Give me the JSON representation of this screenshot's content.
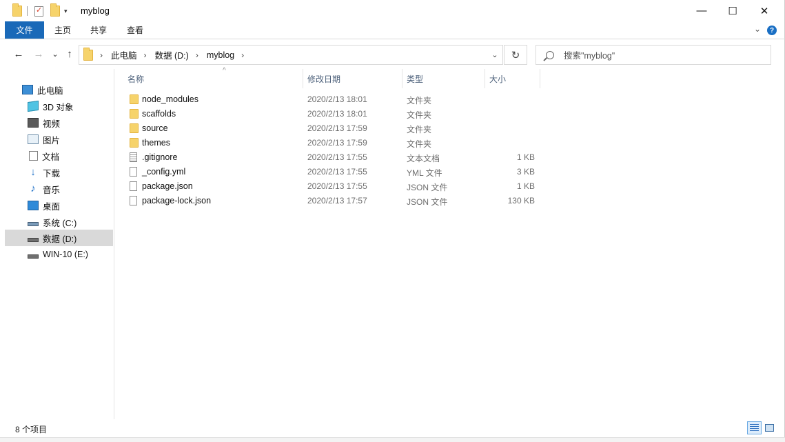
{
  "window": {
    "title": "myblog",
    "minimize_glyph": "—",
    "maximize_glyph": "☐",
    "close_glyph": "✕"
  },
  "ribbon": {
    "tabs": [
      {
        "label": "文件"
      },
      {
        "label": "主页"
      },
      {
        "label": "共享"
      },
      {
        "label": "查看"
      }
    ],
    "collapse_glyph": "⌄",
    "help_glyph": "?"
  },
  "nav": {
    "back_glyph": "←",
    "forward_glyph": "→",
    "recent_glyph": "⌄",
    "up_glyph": "↑",
    "breadcrumbs": [
      "此电脑",
      "数据 (D:)",
      "myblog"
    ],
    "crumb_sep": "›",
    "address_dropdown_glyph": "⌄",
    "refresh_glyph": "↻",
    "search_placeholder": "搜索\"myblog\""
  },
  "sidebar": {
    "items": [
      {
        "label": "此电脑",
        "icon": "computer-icon"
      },
      {
        "label": "3D 对象",
        "icon": "3d-objects-icon"
      },
      {
        "label": "视频",
        "icon": "video-icon"
      },
      {
        "label": "图片",
        "icon": "pictures-icon"
      },
      {
        "label": "文档",
        "icon": "documents-icon"
      },
      {
        "label": "下载",
        "icon": "download-icon"
      },
      {
        "label": "音乐",
        "icon": "music-icon"
      },
      {
        "label": "桌面",
        "icon": "desktop-icon"
      },
      {
        "label": "系统 (C:)",
        "icon": "system-drive-icon"
      },
      {
        "label": "数据 (D:)",
        "icon": "drive-icon"
      },
      {
        "label": "WIN-10 (E:)",
        "icon": "drive-icon"
      }
    ],
    "selected": "数据 (D:)"
  },
  "list": {
    "columns": {
      "name": "名称",
      "modified": "修改日期",
      "type": "类型",
      "size": "大小"
    },
    "sort_glyph": "^",
    "files": [
      {
        "name": "node_modules",
        "modified": "2020/2/13 18:01",
        "type": "文件夹",
        "size": "",
        "icon": "folder-icon"
      },
      {
        "name": "scaffolds",
        "modified": "2020/2/13 18:01",
        "type": "文件夹",
        "size": "",
        "icon": "folder-icon"
      },
      {
        "name": "source",
        "modified": "2020/2/13 17:59",
        "type": "文件夹",
        "size": "",
        "icon": "folder-icon"
      },
      {
        "name": "themes",
        "modified": "2020/2/13 17:59",
        "type": "文件夹",
        "size": "",
        "icon": "folder-icon"
      },
      {
        "name": ".gitignore",
        "modified": "2020/2/13 17:55",
        "type": "文本文档",
        "size": "1 KB",
        "icon": "text-file-icon"
      },
      {
        "name": "_config.yml",
        "modified": "2020/2/13 17:55",
        "type": "YML 文件",
        "size": "3 KB",
        "icon": "file-icon"
      },
      {
        "name": "package.json",
        "modified": "2020/2/13 17:55",
        "type": "JSON 文件",
        "size": "1 KB",
        "icon": "file-icon"
      },
      {
        "name": "package-lock.json",
        "modified": "2020/2/13 17:57",
        "type": "JSON 文件",
        "size": "130 KB",
        "icon": "file-icon"
      }
    ]
  },
  "status": {
    "item_count": "8 个项目"
  }
}
